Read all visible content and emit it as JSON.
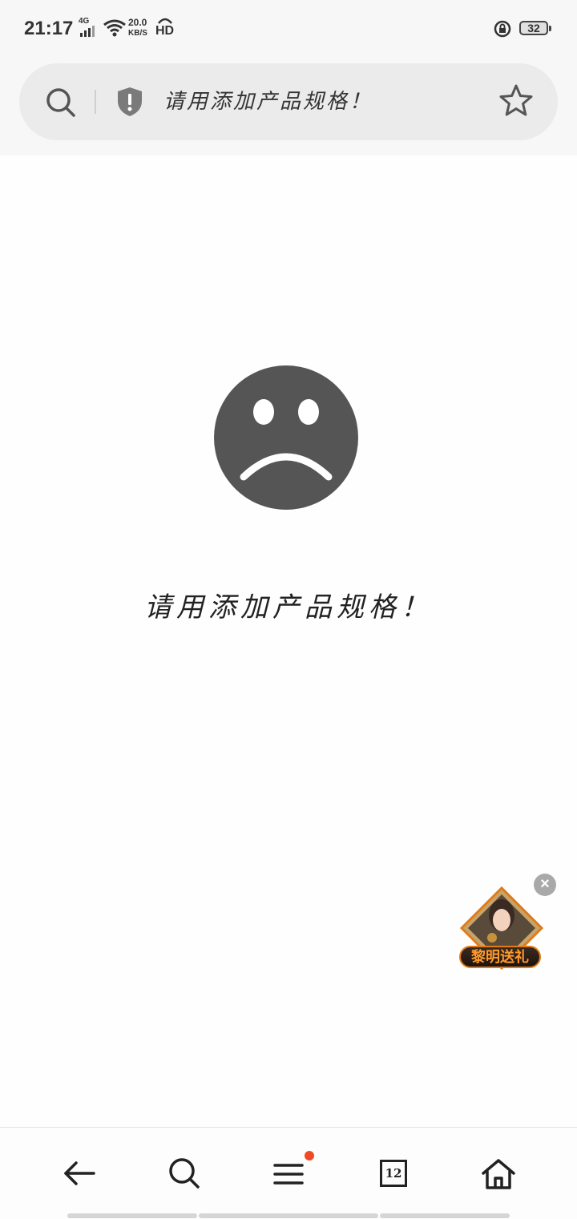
{
  "status_bar": {
    "time": "21:17",
    "network": "4G",
    "speed_value": "20.0",
    "speed_unit": "KB/S",
    "hd": "HD",
    "battery": "32"
  },
  "address_bar": {
    "title": "请用添加产品规格！",
    "icons": [
      "search-icon",
      "shield-icon",
      "star-icon"
    ]
  },
  "main": {
    "message": "请用添加产品规格！",
    "illustration": "sad-face-icon"
  },
  "promo": {
    "label": "黎明送礼",
    "close": "×"
  },
  "bottom_nav": {
    "tabs_count": "12",
    "items": [
      "back-icon",
      "search-icon",
      "menu-icon",
      "tabs-icon",
      "home-icon"
    ]
  },
  "colors": {
    "accent_dot": "#f04a24",
    "face": "#555555",
    "promo_orange": "#ff9a2a"
  }
}
